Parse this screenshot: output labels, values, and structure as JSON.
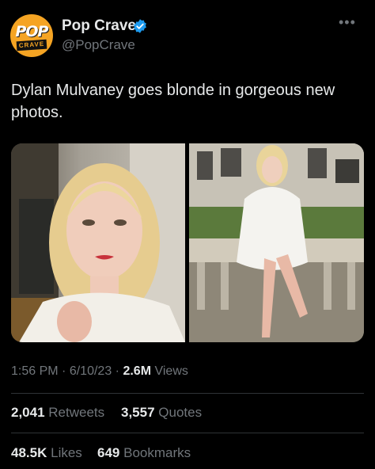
{
  "account": {
    "name": "Pop Crave",
    "handle": "@PopCrave",
    "avatar_top": "POP",
    "avatar_bottom": "CRAVE",
    "verified_color": "#1d9bf0"
  },
  "tweet": {
    "text": "Dylan Mulvaney goes blonde in gorgeous new photos.",
    "time": "1:56 PM",
    "date": "6/10/23",
    "views": "2.6M",
    "views_label": "Views"
  },
  "stats": {
    "retweets": "2,041",
    "retweets_label": "Retweets",
    "quotes": "3,557",
    "quotes_label": "Quotes",
    "likes": "48.5K",
    "likes_label": "Likes",
    "bookmarks": "649",
    "bookmarks_label": "Bookmarks"
  },
  "icons": {
    "more": "more-options-icon",
    "verified": "verified-badge-icon"
  }
}
